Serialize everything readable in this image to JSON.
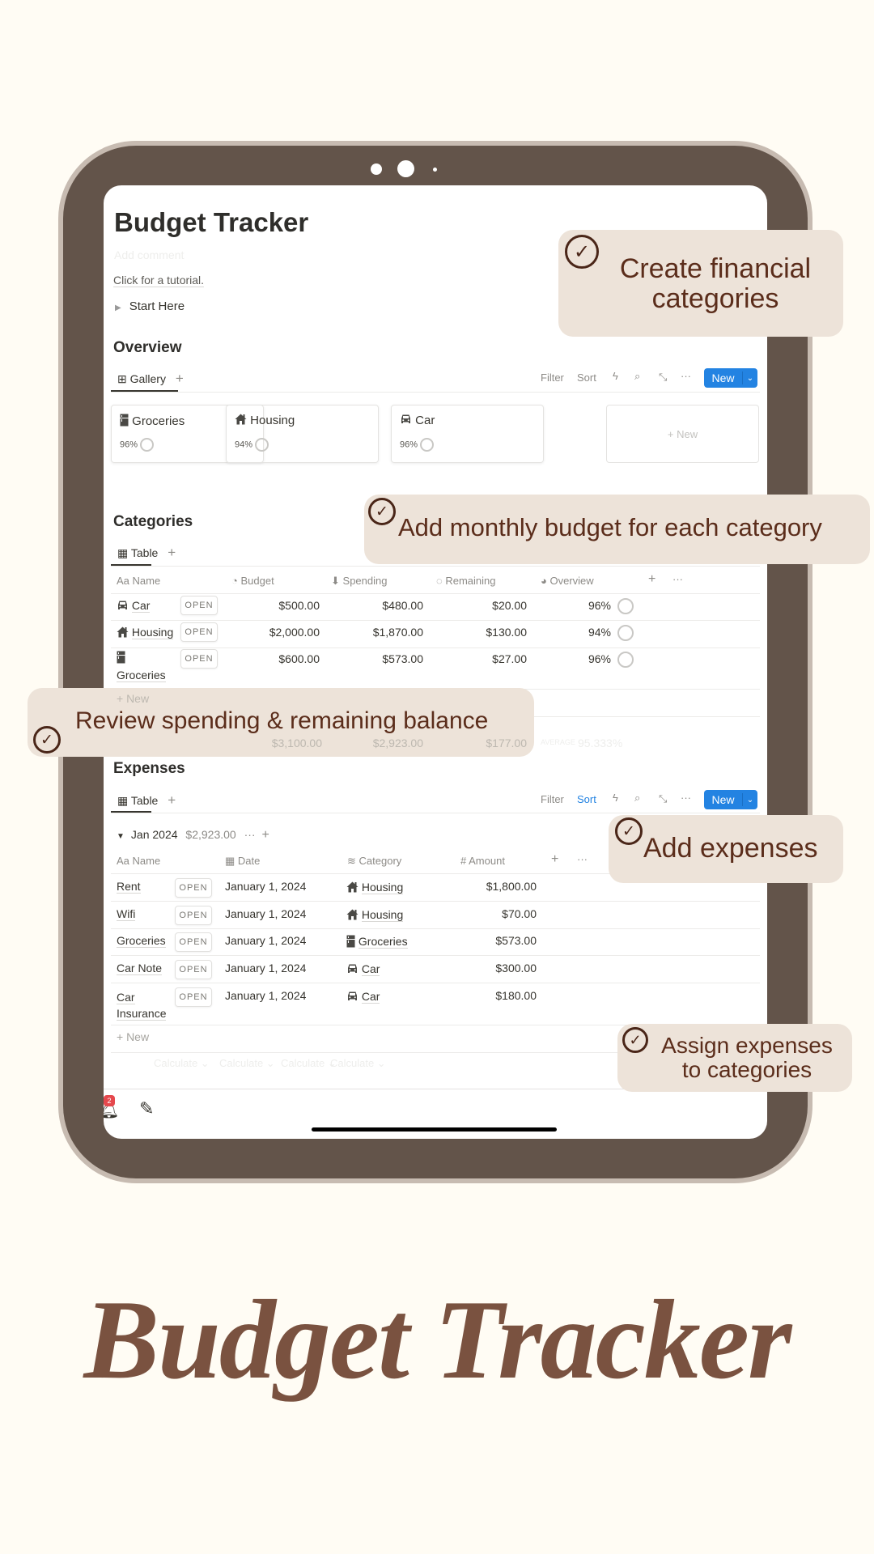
{
  "page": {
    "title": "Budget Tracker",
    "comment_placeholder": "Add comment",
    "tutorial": "Click for a tutorial.",
    "toggle": "Start Here"
  },
  "toolbar": {
    "filter": "Filter",
    "sort": "Sort",
    "new": "New"
  },
  "overview": {
    "heading": "Overview",
    "view_tab": "Gallery",
    "cards": [
      {
        "name": "Groceries",
        "pct": "96%",
        "icon": "fridge-icon"
      },
      {
        "name": "Housing",
        "pct": "94%",
        "icon": "house-icon"
      },
      {
        "name": "Car",
        "pct": "96%",
        "icon": "car-icon"
      }
    ],
    "new_card": "+ New"
  },
  "categories": {
    "heading": "Categories",
    "view_tab": "Table",
    "columns": [
      "Name",
      "Budget",
      "Spending",
      "Remaining",
      "Overview"
    ],
    "name_prefix": "Aa",
    "open": "OPEN",
    "rows": [
      {
        "name": "Car",
        "icon": "car-icon",
        "budget": "$500.00",
        "spending": "$480.00",
        "remaining": "$20.00",
        "overview": "96%"
      },
      {
        "name": "Housing",
        "icon": "house-icon",
        "budget": "$2,000.00",
        "spending": "$1,870.00",
        "remaining": "$130.00",
        "overview": "94%"
      },
      {
        "name": "Groceries",
        "icon": "fridge-icon",
        "budget": "$600.00",
        "spending": "$573.00",
        "remaining": "$27.00",
        "overview": "96%"
      }
    ],
    "new_row": "+ New",
    "sum": {
      "budget": "$3,100.00",
      "spending": "$2,923.00",
      "remaining": "$177.00",
      "avg_label": "AVERAGE",
      "avg": "95.333%"
    }
  },
  "expenses": {
    "heading": "Expenses",
    "view_tab": "Table",
    "group": {
      "label": "Jan 2024",
      "total": "$2,923.00"
    },
    "columns": [
      "Name",
      "Date",
      "Category",
      "Amount"
    ],
    "name_prefix": "Aa",
    "open": "OPEN",
    "rows": [
      {
        "name": "Rent",
        "date": "January 1, 2024",
        "category": "Housing",
        "icon": "house-icon",
        "amount": "$1,800.00"
      },
      {
        "name": "Wifi",
        "date": "January 1, 2024",
        "category": "Housing",
        "icon": "house-icon",
        "amount": "$70.00"
      },
      {
        "name": "Groceries",
        "date": "January 1, 2024",
        "category": "Groceries",
        "icon": "fridge-icon",
        "amount": "$573.00"
      },
      {
        "name": "Car Note",
        "date": "January 1, 2024",
        "category": "Car",
        "icon": "car-icon",
        "amount": "$300.00"
      },
      {
        "name": "Car Insurance",
        "name_l1": "Car",
        "name_l2": "Insurance",
        "date": "January 1, 2024",
        "category": "Car",
        "icon": "car-icon",
        "amount": "$180.00"
      }
    ],
    "new_row": "+ New",
    "calculate": "Calculate ⌄"
  },
  "bottom_bar": {
    "badge": "2"
  },
  "callouts": {
    "c1_l1": "Create financial",
    "c1_l2": "categories",
    "c2": "Add monthly budget for each category",
    "c3": "Review spending & remaining balance",
    "c4": "Add expenses",
    "c5_l1": "Assign expenses",
    "c5_l2": "to categories"
  },
  "hero_title": "Budget Tracker",
  "colors": {
    "background": "#fffcf4",
    "tablet": "#63544a",
    "callout": "#ede3d9",
    "callout_text": "#5b2d1b",
    "accent": "#2383e2",
    "title": "#7a5240"
  }
}
